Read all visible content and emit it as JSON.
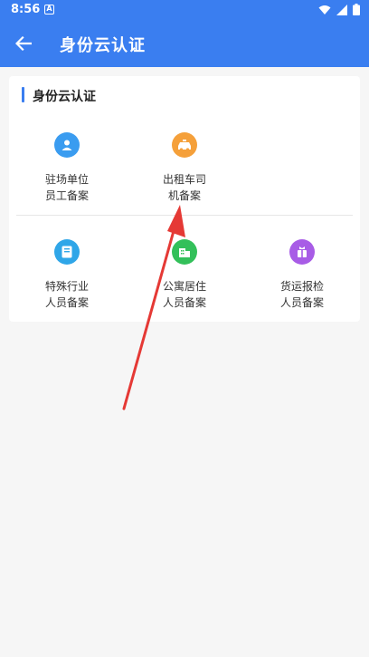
{
  "status": {
    "time": "8:56",
    "notification_letter": "A"
  },
  "app_bar": {
    "title": "身份云认证"
  },
  "section": {
    "title": "身份云认证"
  },
  "items": [
    {
      "line1": "驻场单位",
      "line2": "员工备案",
      "icon": "person-icon",
      "color": "#3a9cf0"
    },
    {
      "line1": "出租车司",
      "line2": "机备案",
      "icon": "taxi-icon",
      "color": "#f5a03a"
    },
    {
      "line1": "特殊行业",
      "line2": "人员备案",
      "icon": "book-icon",
      "color": "#2fa6e8"
    },
    {
      "line1": "公寓居住",
      "line2": "人员备案",
      "icon": "building-icon",
      "color": "#33c05a"
    },
    {
      "line1": "货运报检",
      "line2": "人员备案",
      "icon": "package-icon",
      "color": "#a85ce6"
    }
  ],
  "annotation": {
    "type": "arrow",
    "color": "#e53935"
  }
}
